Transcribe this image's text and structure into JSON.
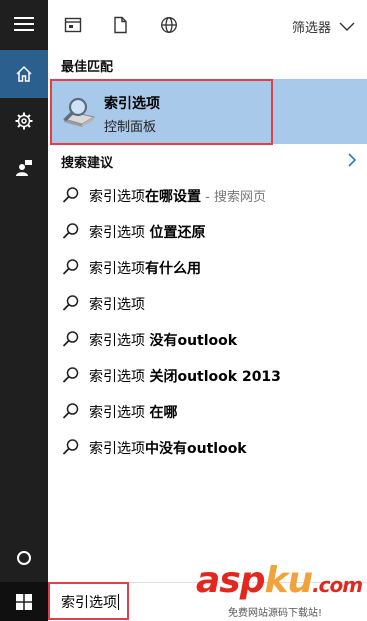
{
  "toolbar": {
    "filter_label": "筛选器"
  },
  "best_match": {
    "section_label": "最佳匹配",
    "title": "索引选项",
    "subtitle": "控制面板"
  },
  "suggestions": {
    "section_label": "搜索建议",
    "items": [
      {
        "prefix": "索引选项",
        "bold": "在哪设置",
        "web": " - 搜索网页"
      },
      {
        "prefix": "索引选项 ",
        "bold": "位置还原",
        "web": ""
      },
      {
        "prefix": "索引选项",
        "bold": "有什么用",
        "web": ""
      },
      {
        "prefix": "索引选项",
        "bold": "",
        "web": ""
      },
      {
        "prefix": "索引选项 ",
        "bold": "没有outlook",
        "web": ""
      },
      {
        "prefix": "索引选项 ",
        "bold": "关闭outlook 2013",
        "web": ""
      },
      {
        "prefix": "索引选项 ",
        "bold": "在哪",
        "web": ""
      },
      {
        "prefix": "索引选项",
        "bold": "中没有outlook",
        "web": ""
      }
    ]
  },
  "search": {
    "value": "索引选项"
  },
  "watermark": {
    "brand_a": "asp",
    "brand_b": "ku",
    "brand_c": ".com",
    "tagline": "免费网站源码下载站!"
  },
  "colors": {
    "rail_bg": "#1f1f1f",
    "rail_active": "#2b5f8e",
    "best_match_bg": "#a8c9ea",
    "highlight_border": "#e0404a"
  }
}
